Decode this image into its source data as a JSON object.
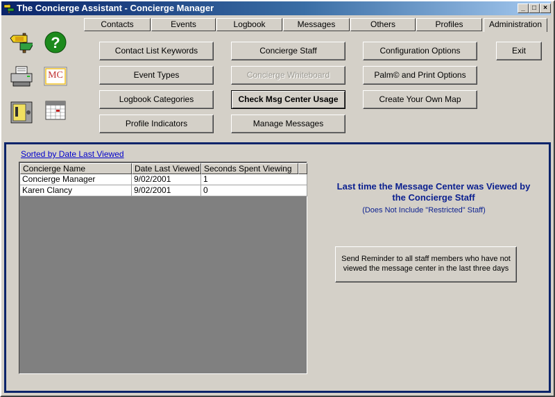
{
  "window": {
    "title": "The Concierge Assistant - Concierge Manager",
    "minimize_label": "_",
    "maximize_label": "□",
    "close_label": "×"
  },
  "tabs": [
    {
      "label": "Contacts",
      "active": false
    },
    {
      "label": "Events",
      "active": false
    },
    {
      "label": "Logbook",
      "active": false
    },
    {
      "label": "Messages",
      "active": false
    },
    {
      "label": "Others",
      "active": false
    },
    {
      "label": "Profiles",
      "active": false
    },
    {
      "label": "Administration",
      "active": true
    }
  ],
  "toolbar_icons": [
    "signpost-icon",
    "help-icon",
    "printer-icon",
    "message-center-icon",
    "safe-icon",
    "calendar-icon"
  ],
  "mc_icon_text": "MC",
  "buttons": {
    "contact_list_keywords": "Contact List Keywords",
    "event_types": "Event Types",
    "logbook_categories": "Logbook Categories",
    "profile_indicators": "Profile Indicators",
    "concierge_staff": "Concierge Staff",
    "concierge_whiteboard": "Concierge Whiteboard",
    "check_msg_center_usage": "Check Msg Center Usage",
    "manage_messages": "Manage Messages",
    "configuration_options": "Configuration Options",
    "palm_print_options": "Palm© and Print Options",
    "create_map": "Create Your Own Map",
    "exit": "Exit"
  },
  "panel": {
    "sort_label": "Sorted by Date Last Viewed",
    "columns": [
      "Concierge Name",
      "Date Last Viewed",
      "Seconds Spent Viewing"
    ],
    "rows": [
      [
        "Concierge Manager",
        "9/02/2001",
        "1"
      ],
      [
        "Karen Clancy",
        "9/02/2001",
        "0"
      ]
    ],
    "info_title": "Last time the Message Center was Viewed by the Concierge Staff",
    "info_subtitle": "(Does Not Include \"Restricted\" Staff)",
    "reminder_button": "Send Reminder to all staff members who have not viewed the message center in the last three days"
  },
  "colors": {
    "face": "#d4d0c8",
    "title_start": "#0a246a",
    "panel_border": "#0a246a",
    "info_text": "#0a1f8f",
    "link": "#0000cc",
    "grid_bg": "#808080"
  }
}
